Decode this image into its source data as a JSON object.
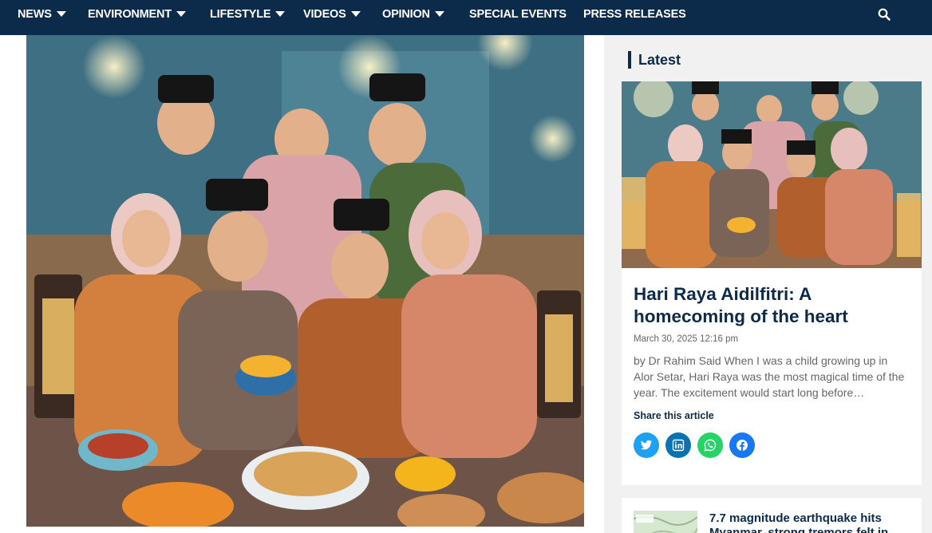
{
  "nav": {
    "items": [
      {
        "label": "NEWS",
        "dropdown": true
      },
      {
        "label": "ENVIRONMENT",
        "dropdown": true
      },
      {
        "label": "LIFESTYLE",
        "dropdown": true
      },
      {
        "label": "VIDEOS",
        "dropdown": true
      },
      {
        "label": "OPINION",
        "dropdown": true
      },
      {
        "label": "SPECIAL EVENTS",
        "dropdown": false
      },
      {
        "label": "PRESS RELEASES",
        "dropdown": false
      }
    ],
    "search_icon": "search-icon",
    "background": "#0c2a49"
  },
  "sidebar": {
    "heading": "Latest",
    "featured": {
      "title": "Hari Raya Aidilfitri: A homecoming of the heart",
      "date": "March 30, 2025 12:16 pm",
      "excerpt": "by Dr Rahim Said When I was a child growing up in Alor Setar, Hari Raya was the most magical time of the year. The excitement would start long before…",
      "share_label": "Share this article",
      "share": [
        {
          "icon": "twitter-icon",
          "color": "#1da1f2"
        },
        {
          "icon": "linkedin-icon",
          "color": "#0a72b1"
        },
        {
          "icon": "whatsapp-icon",
          "color": "#25d366"
        },
        {
          "icon": "facebook-icon",
          "color": "#1877f2"
        }
      ]
    },
    "next": {
      "title": "7.7 magnitude earthquake hits Myanmar, strong tremors felt in"
    }
  },
  "colors": {
    "accent": "#0c2a49",
    "text_muted": "#666666"
  }
}
